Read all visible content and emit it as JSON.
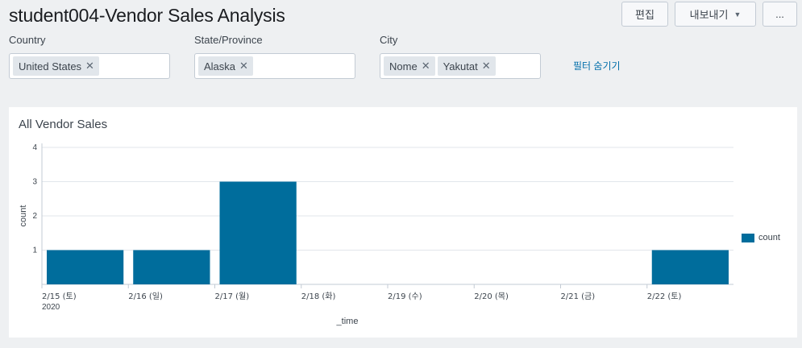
{
  "header": {
    "title": "student004-Vendor Sales Analysis",
    "edit_label": "편집",
    "export_label": "내보내기",
    "more_label": "..."
  },
  "filters": {
    "country": {
      "label": "Country",
      "chips": [
        "United States"
      ]
    },
    "state": {
      "label": "State/Province",
      "chips": [
        "Alaska"
      ]
    },
    "city": {
      "label": "City",
      "chips": [
        "Nome",
        "Yakutat"
      ]
    },
    "hide_link": "필터 숨기기"
  },
  "panel": {
    "title": "All Vendor Sales"
  },
  "chart_data": {
    "type": "bar",
    "title": "All Vendor Sales",
    "xlabel": "_time",
    "ylabel": "count",
    "categories": [
      "2/15 (토)",
      "2/16 (일)",
      "2/17 (월)",
      "2/18 (화)",
      "2/19 (수)",
      "2/20 (목)",
      "2/21 (금)",
      "2/22 (토)"
    ],
    "year_label": "2020",
    "series": [
      {
        "name": "count",
        "values": [
          1,
          1,
          3,
          0,
          0,
          0,
          0,
          1
        ],
        "color": "#006d9c"
      }
    ],
    "ylim": [
      0,
      4
    ],
    "yticks": [
      1,
      2,
      3,
      4
    ],
    "grid": true,
    "legend": "right"
  }
}
